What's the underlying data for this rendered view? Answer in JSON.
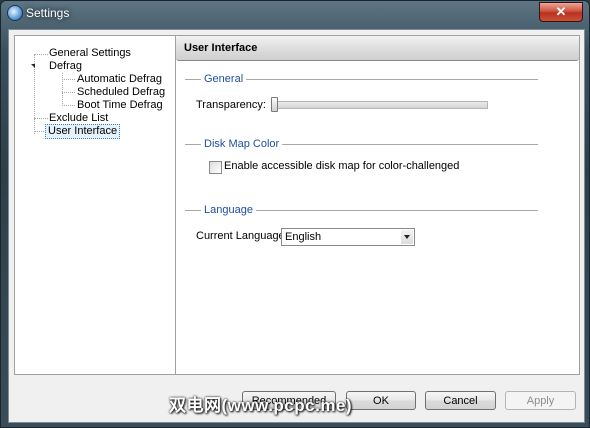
{
  "window": {
    "title": "Settings",
    "close_label": "✕"
  },
  "tree": {
    "items": [
      {
        "label": "General Settings",
        "level": 0
      },
      {
        "label": "Defrag",
        "level": 0
      },
      {
        "label": "Automatic Defrag",
        "level": 1
      },
      {
        "label": "Scheduled Defrag",
        "level": 1
      },
      {
        "label": "Boot Time Defrag",
        "level": 1
      },
      {
        "label": "Exclude List",
        "level": 0
      },
      {
        "label": "User Interface",
        "level": 0,
        "selected": true
      }
    ]
  },
  "content": {
    "title": "User Interface",
    "general": {
      "label": "General",
      "transparency_label": "Transparency:",
      "transparency_value": 0
    },
    "disk_map": {
      "label": "Disk Map Color",
      "checkbox_label": "Enable accessible disk map for color-challenged",
      "checked": false
    },
    "language": {
      "label": "Language",
      "current_label": "Current Language:",
      "value": "English"
    }
  },
  "buttons": {
    "recommended": "Recommended",
    "ok": "OK",
    "cancel": "Cancel",
    "apply": "Apply"
  },
  "watermark": "双电网(www.pcpc.me)",
  "colors": {
    "group_label": "#1f4fa0",
    "selection_border": "#3d7bbf"
  }
}
